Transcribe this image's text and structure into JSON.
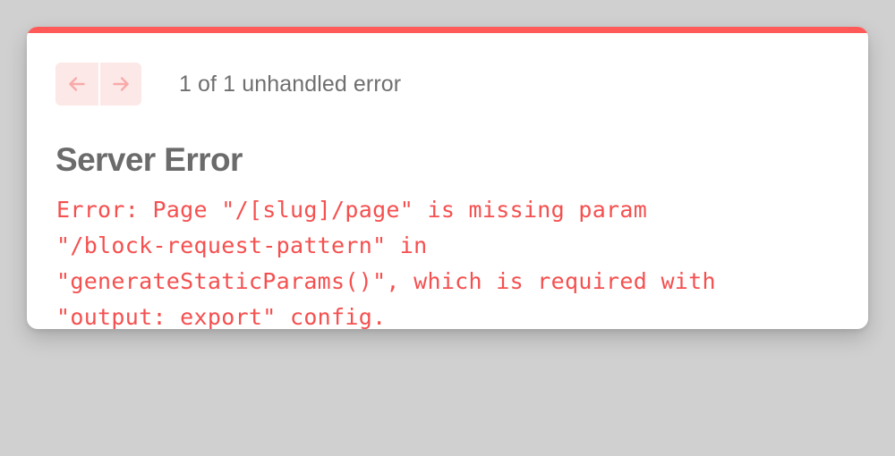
{
  "colors": {
    "accent": "#ff5a57",
    "error_text": "#f4504f",
    "nav_bg": "#fde8e8",
    "nav_arrow": "#f8aaa8"
  },
  "nav": {
    "prev_icon": "arrow-left-icon",
    "next_icon": "arrow-right-icon"
  },
  "header": {
    "counter": "1 of 1 unhandled error"
  },
  "error": {
    "title": "Server Error",
    "message": "Error: Page \"/[slug]/page\" is missing param\n\"/block-request-pattern\" in\n\"generateStaticParams()\", which is required with\n\"output: export\" config."
  }
}
